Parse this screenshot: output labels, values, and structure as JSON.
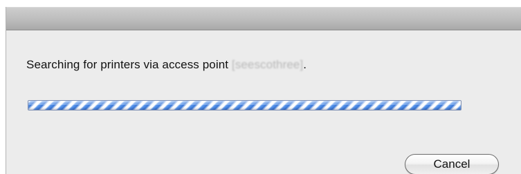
{
  "dialog": {
    "message_prefix": "Searching for printers via access point ",
    "access_point_name": "[seescothree]",
    "message_suffix": ".",
    "progress": {
      "state": "indeterminate",
      "colors": [
        "#3a78d8",
        "#ffffff"
      ]
    },
    "cancel_label": "Cancel"
  }
}
